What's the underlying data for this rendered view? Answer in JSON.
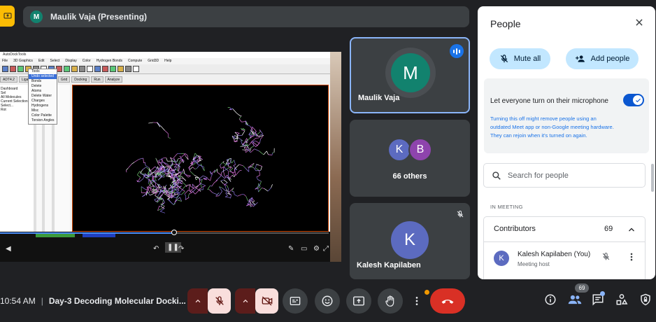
{
  "presenting": {
    "avatar_initial": "M",
    "label": "Maulik Vaja (Presenting)"
  },
  "shared_screen": {
    "app_title": "AutoDockTools",
    "menu": [
      "File",
      "3D Graphics",
      "Edit",
      "Select",
      "Display",
      "Color",
      "Hydrogen Bonds",
      "Compute",
      "Grid3D",
      "Help"
    ],
    "tabs": [
      "ADT4.2",
      "Ligand",
      "Flexible Residues",
      "Grid",
      "Docking",
      "Run",
      "Analyze"
    ],
    "left_labels": [
      "Dashboard",
      "Sel",
      "All Molecules",
      "Current Selection",
      "Select...",
      "Rot"
    ],
    "dropdown_items": [
      "Tools",
      "Undo selected",
      "Bonds",
      "Delete",
      "Atoms",
      "Delete Water",
      "Charges",
      "Hydrogens",
      "Misc",
      "Color Palette",
      "Torsion Angles"
    ],
    "dropdown_selected": "Undo selected",
    "video_progress": 0.53
  },
  "tiles": [
    {
      "name": "Maulik Vaja",
      "initial": "M",
      "color": "#12826e",
      "speaking": true
    },
    {
      "name": "66 others",
      "initials": [
        "K",
        "B"
      ],
      "colors": [
        "#5c6bc0",
        "#8e44ad"
      ]
    },
    {
      "name": "Kalesh Kapilaben",
      "initial": "K",
      "color": "#5c6bc0",
      "muted": true
    }
  ],
  "people_panel": {
    "title": "People",
    "mute_all": "Mute all",
    "add_people": "Add people",
    "mic_setting_label": "Let everyone turn on their microphone",
    "mic_setting_on": true,
    "mic_setting_desc": "Turning this off might remove people using an outdated Meet app or non-Google meeting hardware. They can rejoin when it's turned on again.",
    "search_placeholder": "Search for people",
    "section": "IN MEETING",
    "group": "Contributors",
    "group_count": "69",
    "person": {
      "initial": "K",
      "name": "Kalesh Kapilaben (You)",
      "role": "Meeting host"
    }
  },
  "bottom_bar": {
    "time": "10:54 AM",
    "meeting_title": "Day-3 Decoding Molecular Docki...",
    "participant_count": "69",
    "icons": [
      "mic-off-icon",
      "camera-off-icon",
      "captions-icon",
      "emoji-icon",
      "present-icon",
      "raise-hand-icon",
      "more-icon",
      "end-call-icon",
      "info-icon",
      "people-icon",
      "chat-icon",
      "activities-icon",
      "host-controls-icon"
    ]
  },
  "colors": {
    "background": "#202124",
    "tile": "#3c4043",
    "accent_blue": "#8ab4f8",
    "end_call_red": "#d93025",
    "muted_pink": "#f9dedc"
  }
}
